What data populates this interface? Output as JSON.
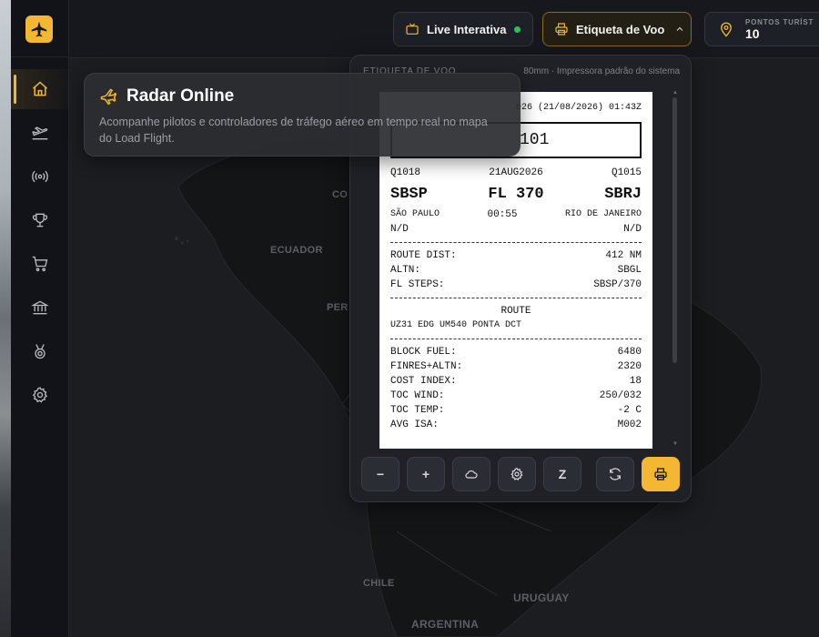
{
  "header": {
    "live_label": "Live Interativa",
    "flight_label_button": "Etiqueta de Voo",
    "points_label": "PONTOS TURÍST",
    "points_value": "10"
  },
  "sidebar": {
    "items": [
      {
        "name": "home",
        "icon": "home-icon",
        "active": true
      },
      {
        "name": "flights",
        "icon": "plane-takeoff-icon"
      },
      {
        "name": "radio",
        "icon": "broadcast-icon"
      },
      {
        "name": "trophy",
        "icon": "trophy-icon"
      },
      {
        "name": "shop",
        "icon": "cart-icon"
      },
      {
        "name": "bank",
        "icon": "bank-icon"
      },
      {
        "name": "medal",
        "icon": "medal-icon"
      },
      {
        "name": "settings",
        "icon": "gear-icon"
      }
    ]
  },
  "map": {
    "labels": {
      "ecuador": "ECUADOR",
      "co": "CO",
      "per": "PER",
      "chile": "CHILE",
      "uruguay": "URUGUAY",
      "argentina": "ARGENTINA"
    }
  },
  "toast": {
    "title": "Radar Online",
    "body": "Acompanhe pilotos e controladores de tráfego aéreo em tempo real no mapa do Load Flight."
  },
  "panel": {
    "title": "ETIQUETA DE VOO",
    "printer": "80mm · Impressora padrão do sistema",
    "ticket": {
      "date_line": "026 (21/08/2026) 01:43Z",
      "flight_box": "101",
      "left_code": "Q1018",
      "date": "21AUG2026",
      "right_code": "Q1015",
      "origin": "SBSP",
      "level": "FL 370",
      "destination": "SBRJ",
      "origin_city": "SÃO PAULO",
      "duration": "00:55",
      "dest_city": "RIO DE JANEIRO",
      "origin_gate": "N/D",
      "dest_gate": "N/D",
      "details1": [
        {
          "k": "ROUTE DIST:",
          "v": "412 NM"
        },
        {
          "k": "ALTN:",
          "v": "SBGL"
        },
        {
          "k": "FL STEPS:",
          "v": "SBSP/370"
        }
      ],
      "route_title": "ROUTE",
      "route": "UZ31 EDG UM540 PONTA DCT",
      "details2": [
        {
          "k": "BLOCK FUEL:",
          "v": "6480"
        },
        {
          "k": "FINRES+ALTN:",
          "v": "2320"
        },
        {
          "k": "COST INDEX:",
          "v": "18"
        },
        {
          "k": "TOC WIND:",
          "v": "250/032"
        },
        {
          "k": "TOC TEMP:",
          "v": "-2 C"
        },
        {
          "k": "AVG ISA:",
          "v": "M002"
        }
      ]
    },
    "toolbar": {
      "zoom_out": "−",
      "zoom_in": "+",
      "z_label": "Z"
    }
  },
  "colors": {
    "accent": "#f4b731",
    "live_dot": "#22c55e"
  }
}
